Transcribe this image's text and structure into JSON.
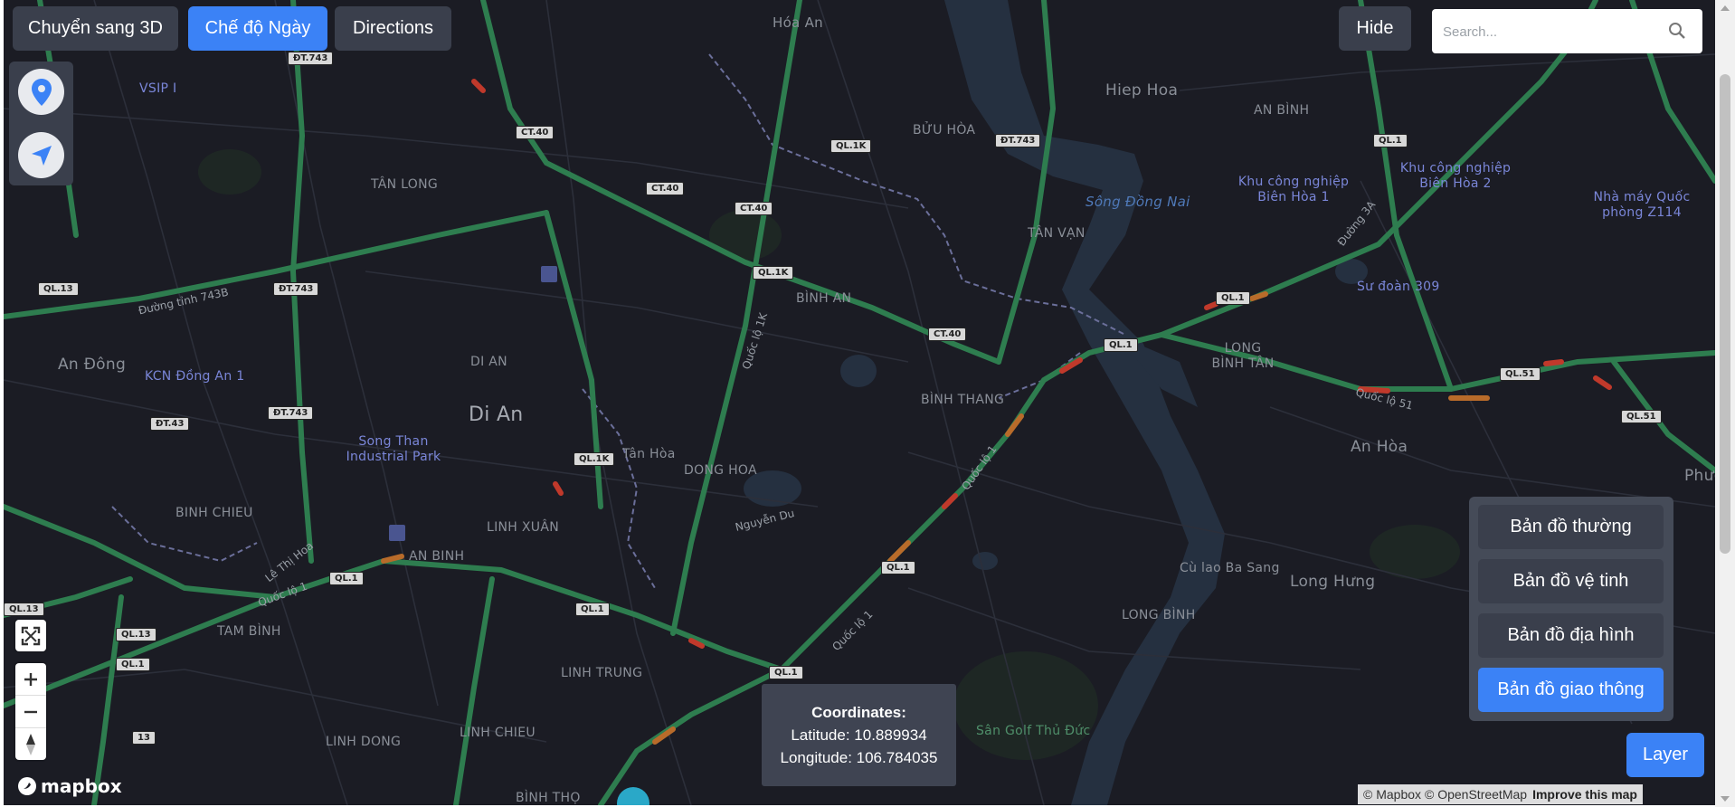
{
  "toolbar": {
    "toggle_3d_label": "Chuyển sang 3D",
    "day_mode_label": "Chế độ Ngày",
    "directions_label": "Directions",
    "hide_label": "Hide"
  },
  "search": {
    "placeholder": "Search...",
    "value": "",
    "icon": "search-icon"
  },
  "side_controls": {
    "icons": [
      "map-pin-icon",
      "navigation-arrow-icon"
    ]
  },
  "map_controls": {
    "icons": [
      "fullscreen-icon",
      "zoom-in-icon",
      "zoom-out-icon",
      "compass-icon"
    ]
  },
  "layers": {
    "items": [
      "Bản đồ thường",
      "Bản đồ vệ tinh",
      "Bản đồ địa hình",
      "Bản đồ giao thông"
    ],
    "active": "Bản đồ giao thông",
    "toggle_label": "Layer"
  },
  "coordinates": {
    "title": "Coordinates:",
    "latitude_line": "Latitude: 10.889934",
    "longitude_line": "Longitude: 106.784035"
  },
  "attribution": {
    "mapbox": "© Mapbox",
    "osm": "© OpenStreetMap",
    "improve": "Improve this map",
    "logo": "mapbox"
  },
  "colors": {
    "map_bg": "#1b1c24",
    "traffic_green": "#2e7d4f",
    "traffic_red": "#c0392b",
    "river": "#253040",
    "accent_blue": "#3b82f6",
    "button_dark": "#3a3f4c"
  },
  "map_labels": {
    "places": [
      "Hóa An",
      "Hiep Hoa",
      "AN BÌNH",
      "BỬU HÒA",
      "TÂN LONG",
      "TÂN VẠN",
      "BÌNH AN",
      "BÌNH THANG",
      "An Đông",
      "DI AN",
      "Di An",
      "Tân Hòa",
      "DONG HOA",
      "LONG BÌNH TÂN",
      "An Hòa",
      "BINH CHIEU",
      "LINH XUÂN",
      "AN BINH",
      "TAM BÌNH",
      "LINH TRUNG",
      "LINH CHIEU",
      "LINH DONG",
      "LONG BÌNH",
      "Long Hưng",
      "Cù lao Ba Sang",
      "BÌNH THỌ",
      "Phướ"
    ],
    "pois": [
      "VSIP I",
      "KCN Đồng An 1",
      "Song Than Industrial Park",
      "Khu công nghiệp Biên Hòa 1",
      "Khu công nghiệp Biên Hòa 2",
      "Nhà máy Quốc phòng Z114",
      "Sư đoàn 309"
    ],
    "water": [
      "Sông Đồng Nai"
    ],
    "parks": [
      "Sân Golf Thủ Đức"
    ],
    "shields": [
      "ĐT.743",
      "CT.40",
      "QL.1K",
      "QL.13",
      "ĐT.43",
      "QL.1",
      "QL.51",
      "13"
    ],
    "road_names": [
      "Đường tỉnh 743B",
      "Quốc lộ 1K",
      "Quốc lộ 1",
      "Quốc lộ 51",
      "Nguyễn Du",
      "Lê Thị Hoa",
      "Đường 3A"
    ]
  }
}
